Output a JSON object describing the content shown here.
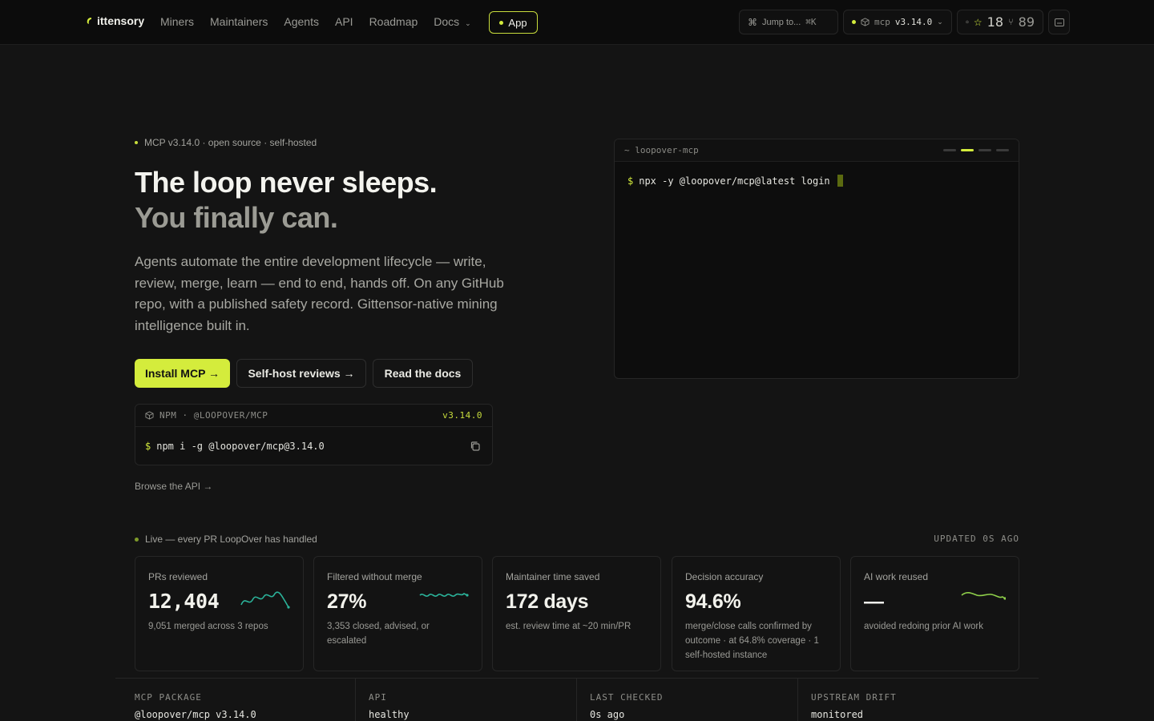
{
  "nav": {
    "brand": "ittensory",
    "links": [
      "Miners",
      "Maintainers",
      "Agents",
      "API",
      "Roadmap",
      "Docs"
    ],
    "app_label": "App",
    "search_label": "Jump to...",
    "search_kbd": "⌘K",
    "version_pkg": "mcp",
    "version": "v3.14.0",
    "stars": "18",
    "forks": "89"
  },
  "hero": {
    "eyebrow": "MCP v3.14.0 · open source · self-hosted",
    "title_line1": "The loop never sleeps.",
    "title_line2": "You finally can.",
    "lede": "Agents automate the entire development lifecycle — write, review, merge, learn — end to end, hands off. On any GitHub repo, with a published safety record. Gittensor-native mining intelligence built in.",
    "btn_install": "Install MCP →",
    "btn_selfhost": "Self-host reviews →",
    "btn_docs": "Read the docs",
    "npm_label": "NPM · @LOOPOVER/MCP",
    "npm_version": "v3.14.0",
    "npm_prompt": "$",
    "npm_command": "npm i -g @loopover/mcp@3.14.0",
    "browse": "Browse the API →"
  },
  "terminal": {
    "title": "~ loopover-mcp",
    "prompt": "$",
    "command": "npx -y @loopover/mcp@latest login"
  },
  "live": {
    "label": "Live — every PR LoopOver has handled",
    "updated": "UPDATED 0S AGO",
    "stats": [
      {
        "label": "PRs reviewed",
        "value": "12,404",
        "sub": "9,051 merged across 3 repos"
      },
      {
        "label": "Filtered without merge",
        "value": "27%",
        "sub": "3,353 closed, advised, or escalated"
      },
      {
        "label": "Maintainer time saved",
        "value": "172 days",
        "sub": "est. review time at ~20 min/PR"
      },
      {
        "label": "Decision accuracy",
        "value": "94.6%",
        "sub": "merge/close calls confirmed by outcome · at 64.8% coverage · 1 self-hosted instance"
      },
      {
        "label": "AI work reused",
        "value": "—",
        "sub": "avoided redoing prior AI work"
      }
    ]
  },
  "strip": [
    {
      "key": "MCP PACKAGE",
      "value": "@loopover/mcp v3.14.0"
    },
    {
      "key": "API",
      "value": "healthy"
    },
    {
      "key": "LAST CHECKED",
      "value": "0s ago"
    },
    {
      "key": "UPSTREAM DRIFT",
      "value": "monitored"
    }
  ],
  "colors": {
    "accent": "#d4ec3c",
    "spark_teal": "#2bb39a",
    "spark_green": "#8fd04a"
  }
}
